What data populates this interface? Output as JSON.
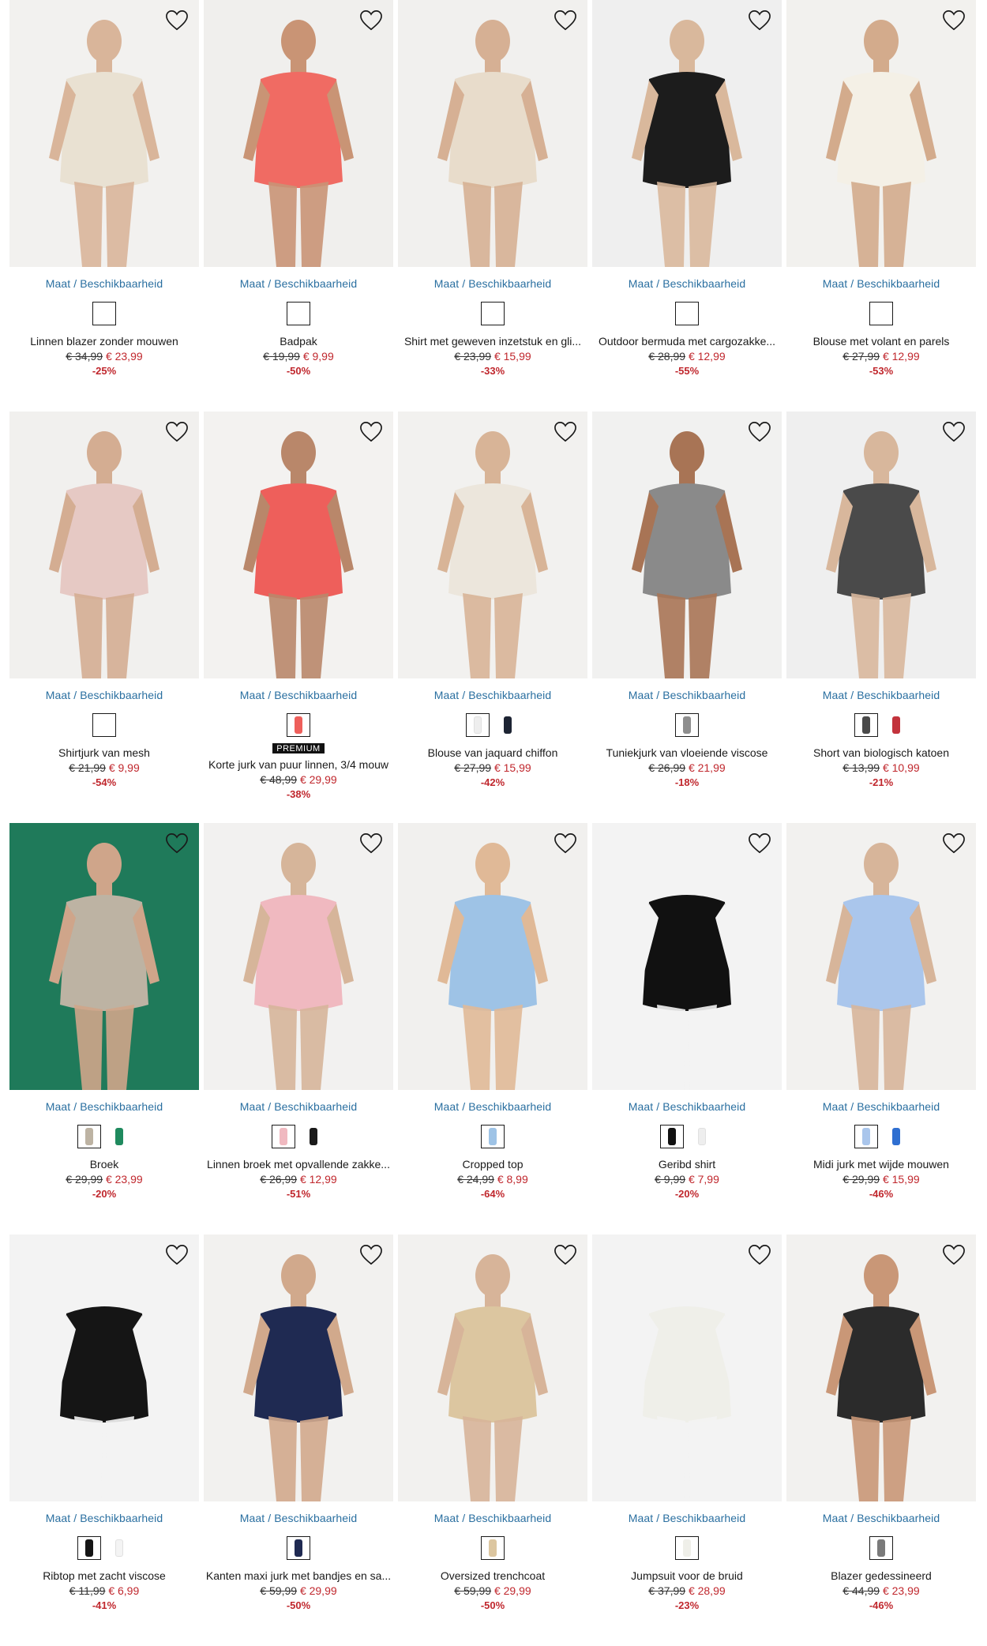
{
  "labels": {
    "availability": "Maat / Beschikbaarheid",
    "wishlist_icon": "heart-outline-icon"
  },
  "colors": {
    "link": "#2a6fa0",
    "sale": "#c0272d",
    "text": "#1a1a1a"
  },
  "products": [
    {
      "name": "Linnen blazer zonder mouwen",
      "old_price": "€ 34,99",
      "new_price": "€ 23,99",
      "discount": "-25%",
      "bg": "#f2f1ef",
      "garment": "#e9e1d2",
      "skin": "#d9b59a",
      "swatches": [
        {
          "c": "#ffffff",
          "plain": false
        }
      ]
    },
    {
      "name": "Badpak",
      "old_price": "€ 19,99",
      "new_price": "€ 9,99",
      "discount": "-50%",
      "bg": "#f0efed",
      "garment": "#f06b63",
      "skin": "#c99475",
      "swatches": [
        {
          "c": "#ffffff",
          "plain": false
        }
      ]
    },
    {
      "name": "Shirt met geweven inzetstuk en gli...",
      "old_price": "€ 23,99",
      "new_price": "€ 15,99",
      "discount": "-33%",
      "bg": "#f1f0ee",
      "garment": "#e8dccb",
      "skin": "#d6b094",
      "swatches": [
        {
          "c": "#ffffff",
          "plain": false
        }
      ]
    },
    {
      "name": "Outdoor bermuda met cargozakke...",
      "old_price": "€ 28,99",
      "new_price": "€ 12,99",
      "discount": "-55%",
      "bg": "#efefef",
      "garment": "#1c1c1c",
      "skin": "#d9b89c",
      "swatches": [
        {
          "c": "#ffffff",
          "plain": false
        }
      ]
    },
    {
      "name": "Blouse met volant en parels",
      "old_price": "€ 27,99",
      "new_price": "€ 12,99",
      "discount": "-53%",
      "bg": "#f2f1ee",
      "garment": "#f4f0e6",
      "skin": "#d3ab8c",
      "swatches": [
        {
          "c": "#ffffff",
          "plain": false
        }
      ]
    },
    {
      "name": "Shirtjurk van mesh",
      "old_price": "€ 21,99",
      "new_price": "€ 9,99",
      "discount": "-54%",
      "bg": "#f1f0ee",
      "garment": "#e6c9c4",
      "skin": "#d4ad92",
      "swatches": [
        {
          "c": "#ffffff",
          "plain": false
        }
      ]
    },
    {
      "name": "Korte jurk van puur linnen, 3/4 mouw",
      "old_price": "€ 48,99",
      "new_price": "€ 29,99",
      "discount": "-38%",
      "bg": "#f3f2f0",
      "garment": "#ee5f5b",
      "skin": "#b9876a",
      "badge": "PREMIUM",
      "swatches": [
        {
          "c": "#ee5f5b",
          "plain": false
        }
      ]
    },
    {
      "name": "Blouse van jaquard chiffon",
      "old_price": "€ 27,99",
      "new_price": "€ 15,99",
      "discount": "-42%",
      "bg": "#f2f1ef",
      "garment": "#ece6dc",
      "skin": "#d8b497",
      "swatches": [
        {
          "c": "#eeeeee",
          "plain": false
        },
        {
          "c": "#1d2433",
          "plain": true
        }
      ]
    },
    {
      "name": "Tuniekjurk van vloeiende viscose",
      "old_price": "€ 26,99",
      "new_price": "€ 21,99",
      "discount": "-18%",
      "bg": "#f1f1f0",
      "garment": "#8a8a8a",
      "skin": "#a87455",
      "swatches": [
        {
          "c": "#8e8e8e",
          "plain": false
        }
      ]
    },
    {
      "name": "Short van biologisch katoen",
      "old_price": "€ 13,99",
      "new_price": "€ 10,99",
      "discount": "-21%",
      "bg": "#efefef",
      "garment": "#4a4a4a",
      "skin": "#d8b79c",
      "swatches": [
        {
          "c": "#4a4a4a",
          "plain": false
        },
        {
          "c": "#c3333c",
          "plain": true
        }
      ]
    },
    {
      "name": "Broek",
      "old_price": "€ 29,99",
      "new_price": "€ 23,99",
      "discount": "-20%",
      "bg": "#1f7a5a",
      "garment": "#bdb3a3",
      "skin": "#cfa58a",
      "swatches": [
        {
          "c": "#bdb3a3",
          "plain": false
        },
        {
          "c": "#1f8a5e",
          "plain": true
        }
      ]
    },
    {
      "name": "Linnen broek met opvallende zakke...",
      "old_price": "€ 26,99",
      "new_price": "€ 12,99",
      "discount": "-51%",
      "bg": "#f2f1f0",
      "garment": "#f0b9c0",
      "skin": "#d6b59a",
      "swatches": [
        {
          "c": "#f0b9c0",
          "plain": false
        },
        {
          "c": "#1a1a1a",
          "plain": true
        }
      ]
    },
    {
      "name": "Cropped top",
      "old_price": "€ 24,99",
      "new_price": "€ 8,99",
      "discount": "-64%",
      "bg": "#f1f0ee",
      "garment": "#9ec3e6",
      "skin": "#e0b997",
      "swatches": [
        {
          "c": "#9ec3e6",
          "plain": false
        }
      ]
    },
    {
      "name": "Geribd shirt",
      "old_price": "€ 9,99",
      "new_price": "€ 7,99",
      "discount": "-20%",
      "bg": "#f3f3f3",
      "garment": "#111111",
      "skin": "#f3f3f3",
      "swatches": [
        {
          "c": "#111111",
          "plain": false
        },
        {
          "c": "#eeeeee",
          "plain": true
        }
      ]
    },
    {
      "name": "Midi jurk met wijde mouwen",
      "old_price": "€ 29,99",
      "new_price": "€ 15,99",
      "discount": "-46%",
      "bg": "#f2f1ef",
      "garment": "#aac6ec",
      "skin": "#d7b59a",
      "swatches": [
        {
          "c": "#aac6ec",
          "plain": false
        },
        {
          "c": "#2f6fd1",
          "plain": true
        }
      ]
    },
    {
      "name": "Ribtop met zacht viscose",
      "old_price": "€ 11,99",
      "new_price": "€ 6,99",
      "discount": "-41%",
      "bg": "#f3f3f3",
      "garment": "#151515",
      "skin": "#f3f3f3",
      "swatches": [
        {
          "c": "#151515",
          "plain": false
        },
        {
          "c": "#f4f4f4",
          "plain": true
        }
      ]
    },
    {
      "name": "Kanten maxi jurk met bandjes en sa...",
      "old_price": "€ 59,99",
      "new_price": "€ 29,99",
      "discount": "-50%",
      "bg": "#f2f1ef",
      "garment": "#1f2a52",
      "skin": "#d1a98c",
      "swatches": [
        {
          "c": "#1f2a52",
          "plain": false
        }
      ]
    },
    {
      "name": "Oversized trenchcoat",
      "old_price": "€ 59,99",
      "new_price": "€ 29,99",
      "discount": "-50%",
      "bg": "#f2f1ef",
      "garment": "#dcc6a0",
      "skin": "#d7b499",
      "swatches": [
        {
          "c": "#dcc6a0",
          "plain": false
        }
      ]
    },
    {
      "name": "Jumpsuit voor de bruid",
      "old_price": "€ 37,99",
      "new_price": "€ 28,99",
      "discount": "-23%",
      "bg": "#f3f3f3",
      "garment": "#efefe9",
      "skin": "#f3f3f3",
      "swatches": [
        {
          "c": "#efefe9",
          "plain": false
        }
      ]
    },
    {
      "name": "Blazer gedessineerd",
      "old_price": "€ 44,99",
      "new_price": "€ 23,99",
      "discount": "-46%",
      "bg": "#f2f1ef",
      "garment": "#2b2b2b",
      "skin": "#c99777",
      "swatches": [
        {
          "c": "#7a7a7a",
          "plain": false
        }
      ]
    }
  ]
}
